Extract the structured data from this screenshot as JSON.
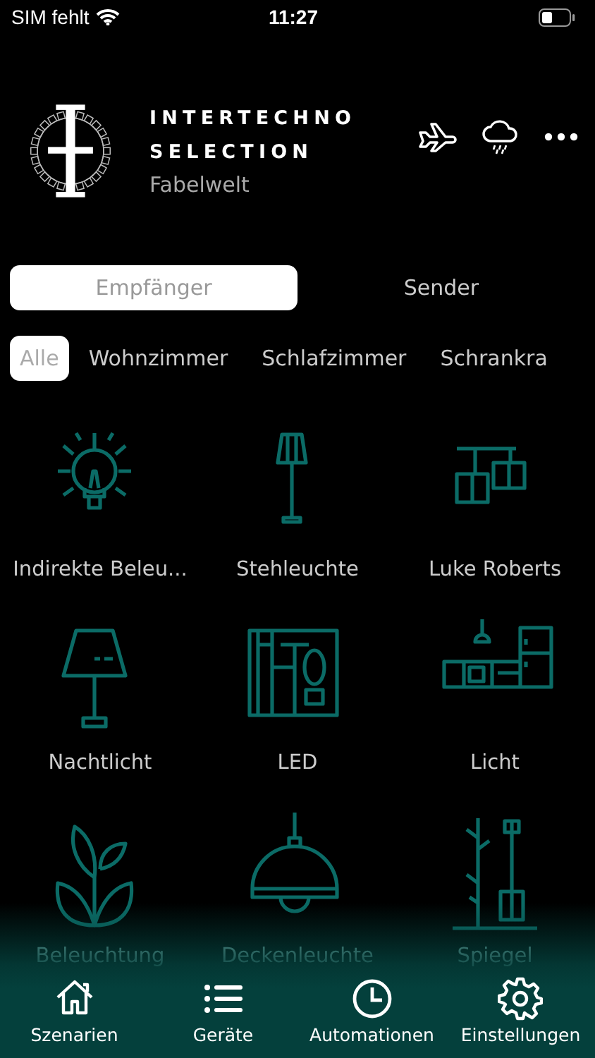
{
  "status_bar": {
    "carrier": "SIM fehlt",
    "time": "11:27"
  },
  "header": {
    "brand_line_1": "INTERTECHNO",
    "brand_line_2": "SELECTION",
    "home_name": "Fabelwelt"
  },
  "segments": [
    {
      "label": "Empfänger",
      "selected": true
    },
    {
      "label": "Sender",
      "selected": false
    }
  ],
  "rooms": [
    {
      "label": "Alle",
      "selected": true
    },
    {
      "label": "Wohnzimmer",
      "selected": false
    },
    {
      "label": "Schlafzimmer",
      "selected": false
    },
    {
      "label": "Schrankra",
      "selected": false
    }
  ],
  "devices": [
    {
      "name": "Indirekte Beleu..."
    },
    {
      "name": "Stehleuchte"
    },
    {
      "name": "Luke Roberts"
    },
    {
      "name": "Nachtlicht"
    },
    {
      "name": "LED"
    },
    {
      "name": "Licht"
    },
    {
      "name": "Beleuchtung"
    },
    {
      "name": "Deckenleuchte"
    },
    {
      "name": "Spiegel"
    }
  ],
  "tab_bar": [
    {
      "label": "Szenarien"
    },
    {
      "label": "Geräte"
    },
    {
      "label": "Automationen"
    },
    {
      "label": "Einstellungen"
    }
  ]
}
